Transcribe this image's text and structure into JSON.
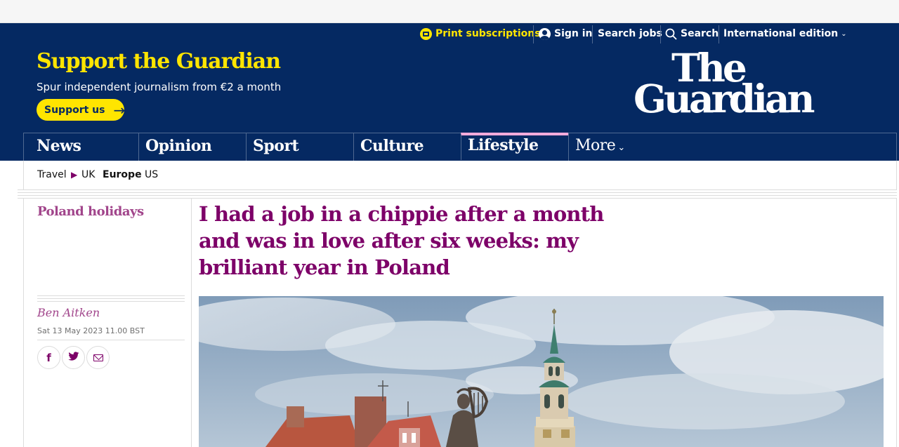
{
  "utility": {
    "print_subscriptions": "Print subscriptions",
    "sign_in": "Sign in",
    "search_jobs": "Search jobs",
    "search": "Search",
    "edition": "International edition"
  },
  "support": {
    "title": "Support the Guardian",
    "subtitle": "Spur independent journalism from €2 a month",
    "button": "Support us"
  },
  "logo": {
    "line1": "The",
    "line2": "Guardian"
  },
  "nav": {
    "items": [
      "News",
      "Opinion",
      "Sport",
      "Culture",
      "Lifestyle"
    ],
    "active": "Lifestyle",
    "more": "More"
  },
  "subnav": {
    "section": "Travel",
    "items": [
      "UK",
      "Europe",
      "US"
    ],
    "active": "Europe"
  },
  "article": {
    "series": "Poland holidays",
    "headline": "I had a job in a chippie after a month and was in love after six weeks: my brilliant year in Poland",
    "author": "Ben Aitken",
    "date": "Sat 13 May 2023 11.00 BST",
    "share": [
      "facebook-icon",
      "twitter-icon",
      "email-icon"
    ]
  },
  "colors": {
    "brand_blue": "#052962",
    "support_yellow": "#ffe500",
    "lifestyle_accent": "#7d0068",
    "lifestyle_pink": "#ffabdb"
  }
}
